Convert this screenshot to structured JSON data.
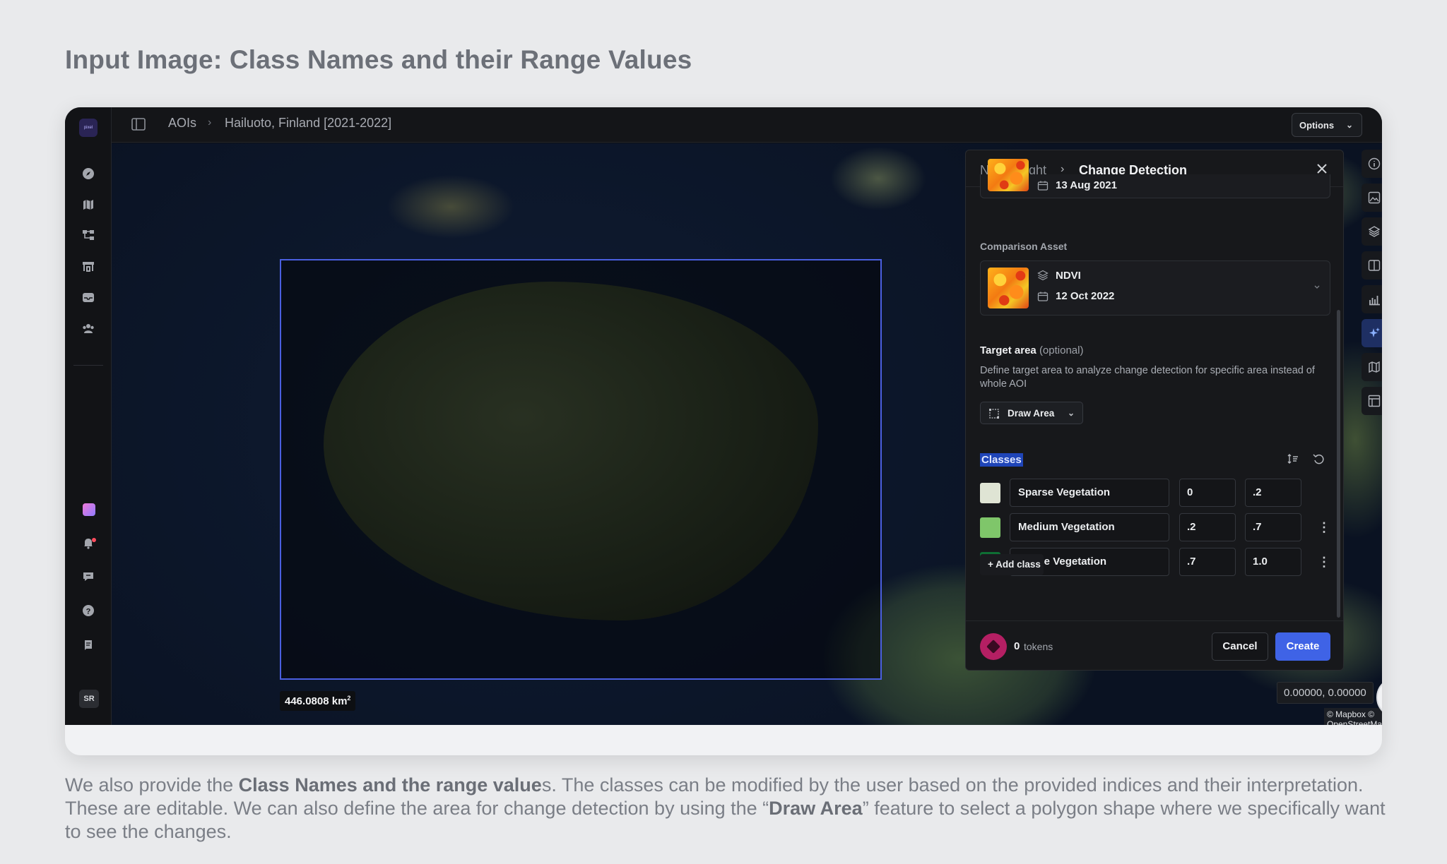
{
  "heading": "Input Image: Class Names and their Range Values",
  "app": {
    "logo_text": "pixel",
    "breadcrumb": {
      "root": "AOIs",
      "current": "Hailuoto, Finland [2021-2022]"
    },
    "options_label": "Options",
    "user_initials": "SR"
  },
  "left_nav": {
    "icons": [
      "compass-icon",
      "map-icon",
      "workflow-icon",
      "store-icon",
      "inbox-icon",
      "team-icon",
      "apps-icon",
      "notifications-icon",
      "feedback-icon",
      "help-icon",
      "docs-icon"
    ]
  },
  "map": {
    "area": "446.0808 km",
    "area_unit_sup": "2",
    "coordinates": "0.00000, 0.00000",
    "attribution": "© Mapbox © OpenStreetMap",
    "compass_label": "N"
  },
  "right_tools": [
    "info-icon",
    "image-icon",
    "layers-icon",
    "split-view-icon",
    "chart-icon",
    "sparkle-icon",
    "map-outline-icon",
    "layout-icon"
  ],
  "panel": {
    "crumb_parent": "New Insight",
    "crumb_current": "Change Detection",
    "base_asset_date": "13 Aug 2021",
    "comparison_label": "Comparison Asset",
    "comparison_index": "NDVI",
    "comparison_date": "12 Oct 2022",
    "target_area_label": "Target area",
    "target_area_optional": "(optional)",
    "target_area_desc": "Define target area to analyze change detection for specific area instead of whole AOI",
    "draw_area_label": "Draw Area",
    "classes_title": "Classes",
    "classes": [
      {
        "name": "Sparse Vegetation",
        "min": "0",
        "max": ".2",
        "color": "#dfe4d4"
      },
      {
        "name": "Medium Vegetation",
        "min": ".2",
        "max": ".7",
        "color": "#7fc66a"
      },
      {
        "name": "Dense Vegetation",
        "min": ".7",
        "max": "1.0",
        "color": "#0e6e34"
      }
    ],
    "add_class_label": "+ Add class",
    "token_count": "0",
    "token_word": "tokens",
    "cancel_label": "Cancel",
    "create_label": "Create"
  },
  "caption": {
    "p1": "We also provide the ",
    "b1": "Class Names and the range value",
    "p2": "s. The classes can be modified by the user based on the provided indices and their interpretation. These are editable. We can also define the area for change detection by using the “",
    "b2": "Draw Area",
    "p3": "” feature to select a polygon shape where we specifically want to see the changes."
  }
}
